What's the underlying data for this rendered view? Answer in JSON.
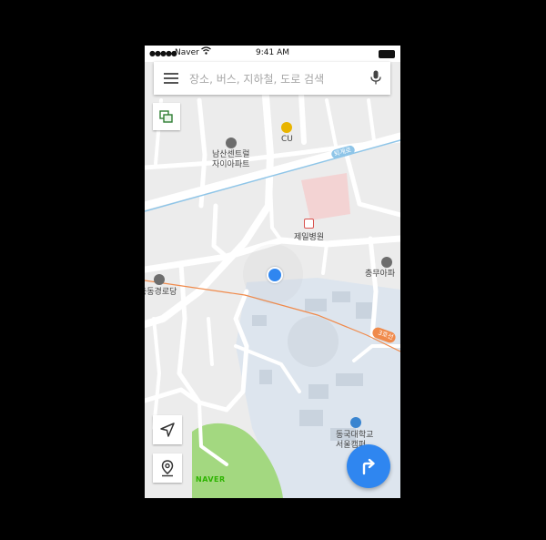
{
  "status_bar": {
    "carrier": "Naver",
    "time": "9:41 AM"
  },
  "search": {
    "placeholder": "장소, 버스, 지하철, 도로 검색"
  },
  "map": {
    "brand": "NAVER",
    "places": {
      "cu": "CU",
      "namsan_1": "남산센트럴",
      "namsan_2": "자이아파트",
      "jeil": "제일병원",
      "chungmu": "충무아파",
      "jangchung": "충동경로당",
      "dongguk_1": "동국대학교",
      "dongguk_2": "서울캠퍼"
    },
    "roads": {
      "upper_line": "퇴계로",
      "lower_line": "3호선"
    }
  },
  "colors": {
    "accent": "#2f86f0",
    "road": "#ffffff",
    "park": "#a3d880",
    "hospital": "#f3d3d3",
    "campus": "#dde5ee",
    "subway": "#f08a4b",
    "poi_gray": "#6d6d6d",
    "poi_cu": "#e8b400",
    "poi_hospital": "#d9534f",
    "poi_school": "#3a85d0"
  }
}
